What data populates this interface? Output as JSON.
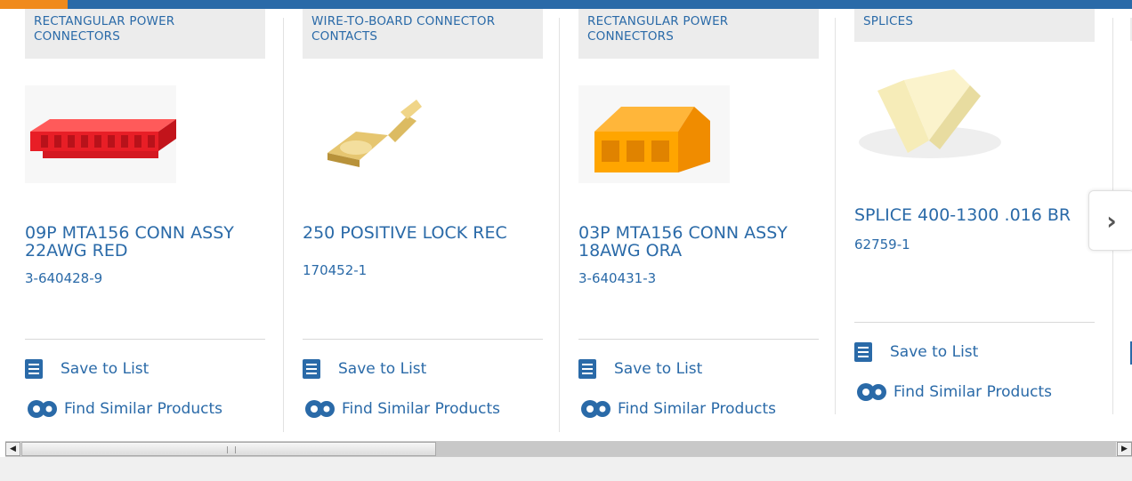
{
  "colors": {
    "accent": "#f08a1c",
    "brand": "#2a6aa8",
    "category_bg": "#ececec"
  },
  "products": [
    {
      "category": "RECTANGULAR POWER CONNECTORS",
      "name": "09P MTA156 CONN ASSY 22AWG RED",
      "part_number": "3-640428-9",
      "save_label": "Save to List",
      "similar_label": "Find Similar Products",
      "image": "red-connector-housing"
    },
    {
      "category": "WIRE-TO-BOARD CONNECTOR CONTACTS",
      "name": "250 POSITIVE LOCK REC",
      "part_number": "170452-1",
      "save_label": "Save to List",
      "similar_label": "Find Similar Products",
      "image": "gold-crimp-contact"
    },
    {
      "category": "RECTANGULAR POWER CONNECTORS",
      "name": "03P MTA156 CONN ASSY 18AWG ORA",
      "part_number": "3-640431-3",
      "save_label": "Save to List",
      "similar_label": "Find Similar Products",
      "image": "orange-connector-housing"
    },
    {
      "category": "SPLICES",
      "name": "SPLICE 400-1300 .016 BR",
      "part_number": "62759-1",
      "save_label": "Save to List",
      "similar_label": "Find Similar Products",
      "image": "cream-splice"
    }
  ],
  "carousel": {
    "next_icon": "chevron-right-icon",
    "next_glyph": "›"
  },
  "scrollbar": {
    "left_glyph": "◀",
    "right_glyph": "▶"
  }
}
